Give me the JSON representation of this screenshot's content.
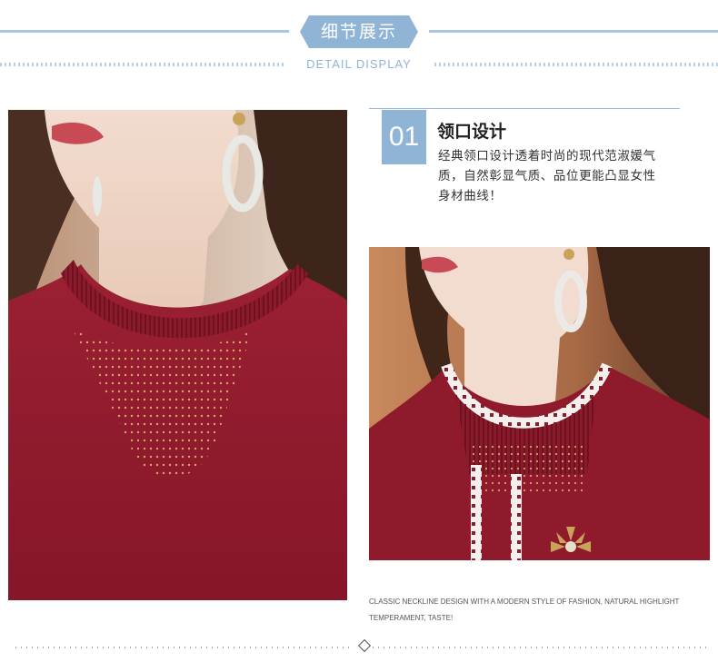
{
  "header": {
    "title": "细节展示",
    "subtitle": "DETAIL DISPLAY"
  },
  "feature": {
    "number": "01",
    "title": "领口设计",
    "description": "经典领口设计透着时尚的现代范淑媛气质，自然彰显气质、品位更能凸显女性身材曲线！",
    "english": "CLASSIC NECKLINE DESIGN WITH A MODERN STYLE OF FASHION, NATURAL HIGHLIGHT TEMPERAMENT, TASTE!"
  },
  "colors": {
    "accent": "#8fb4d6",
    "garment": "#8e1a2c"
  }
}
